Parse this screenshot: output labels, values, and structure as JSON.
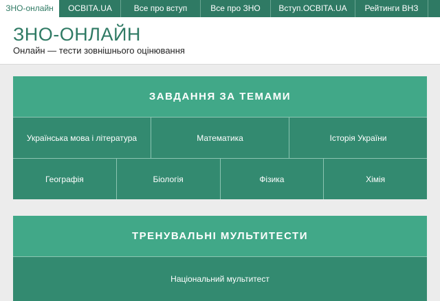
{
  "topnav": {
    "tabs": [
      {
        "label": "ЗНО-онлайн",
        "active": true
      },
      {
        "label": "OCBITA.UA",
        "active": false
      },
      {
        "label": "Все про вступ",
        "active": false
      },
      {
        "label": "Все про ЗНО",
        "active": false
      },
      {
        "label": "Вступ.OCBITA.UA",
        "active": false
      },
      {
        "label": "Рейтинги ВНЗ",
        "active": false
      }
    ]
  },
  "header": {
    "title": "ЗНО-ОНЛАЙН",
    "tagline": "Онлайн — тести зовнішнього оцінювання"
  },
  "section_topics": {
    "heading": "ЗАВДАННЯ ЗА ТЕМАМИ",
    "row1": [
      "Українська мова і література",
      "Математика",
      "Історія України"
    ],
    "row2": [
      "Географія",
      "Біологія",
      "Фізика",
      "Хімія"
    ]
  },
  "section_multitests": {
    "heading": "ТРЕНУВАЛЬНІ МУЛЬТИТЕСТИ",
    "items": [
      "Національний мультитест"
    ]
  },
  "colors": {
    "nav_bg": "#2f7a64",
    "panel_header": "#41a888",
    "panel_cell": "#338a70",
    "page_bg": "#ececec"
  }
}
